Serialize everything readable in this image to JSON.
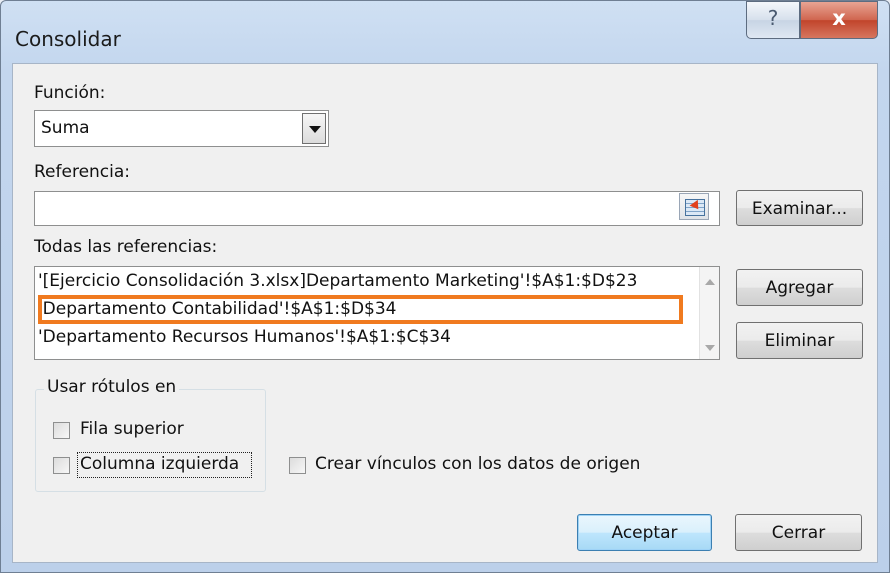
{
  "dialog": {
    "title": "Consolidar",
    "help_glyph": "?",
    "close_glyph": "x"
  },
  "funcion": {
    "label": "Función:",
    "selected": "Suma"
  },
  "referencia": {
    "label": "Referencia:",
    "value": "",
    "browse_label": "Examinar..."
  },
  "todas": {
    "label": "Todas las referencias:",
    "items": [
      "'[Ejercicio Consolidación 3.xlsx]Departamento Marketing'!$A$1:$D$23",
      "'Departamento Contabilidad'!$A$1:$D$34",
      "'Departamento Recursos Humanos'!$A$1:$C$34"
    ],
    "add_label": "Agregar",
    "delete_label": "Eliminar"
  },
  "rotulos": {
    "legend": "Usar rótulos en",
    "fila_superior": {
      "label": "Fila superior",
      "checked": false
    },
    "columna_izquierda": {
      "label": "Columna izquierda",
      "checked": false
    }
  },
  "crear_vinculos": {
    "label": "Crear vínculos con los datos de origen",
    "checked": false
  },
  "footer": {
    "ok_label": "Aceptar",
    "close_label": "Cerrar"
  },
  "colors": {
    "highlight": "#f07a1f",
    "close_button": "#c1442b",
    "default_button": "#bee6fd"
  }
}
